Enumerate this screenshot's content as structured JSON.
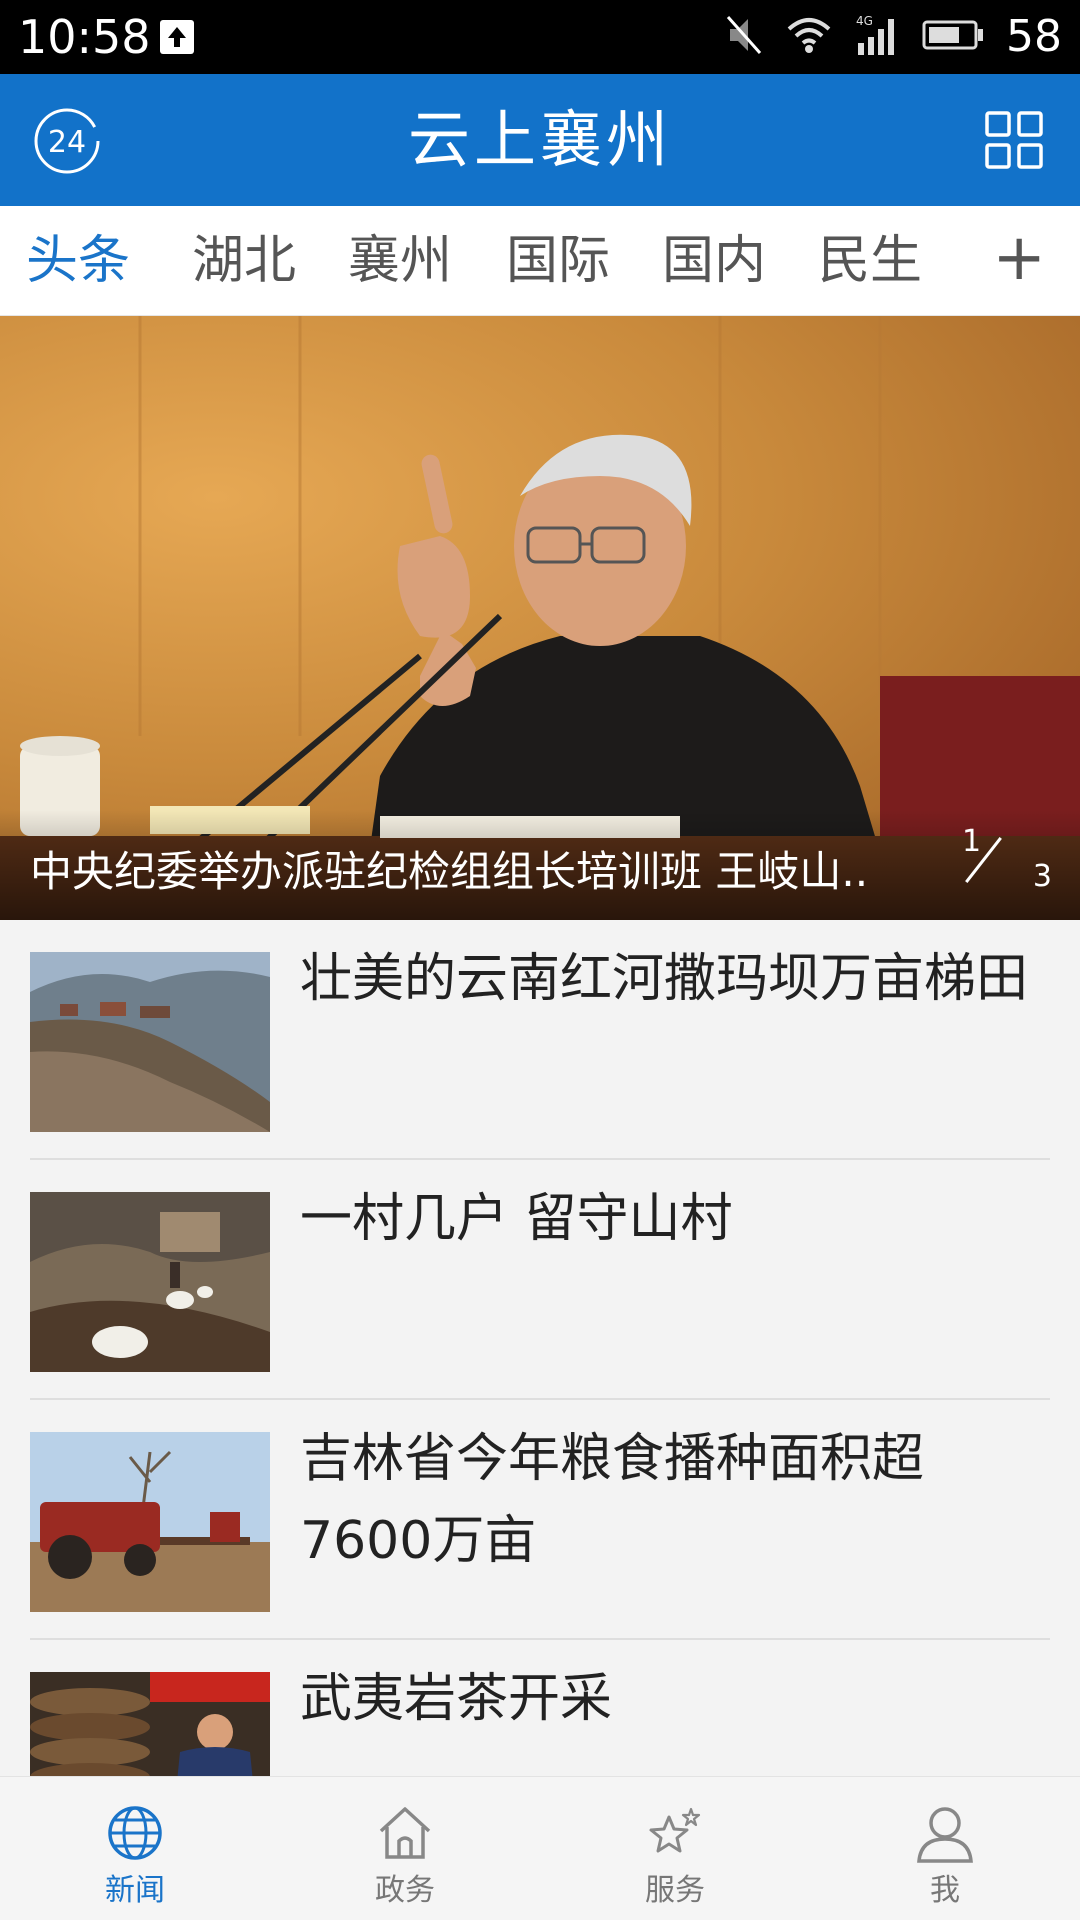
{
  "status_bar": {
    "time": "10:58",
    "battery": "58"
  },
  "header": {
    "title": "云上襄州",
    "left_badge": "24"
  },
  "tabs": [
    {
      "label": "头条",
      "active": true
    },
    {
      "label": "湖北",
      "active": false
    },
    {
      "label": "襄州",
      "active": false
    },
    {
      "label": "国际",
      "active": false
    },
    {
      "label": "国内",
      "active": false
    },
    {
      "label": "民生",
      "active": false
    }
  ],
  "tab_add_label": "+",
  "hero": {
    "caption": "中央纪委举办派驻纪检组组长培训班 王岐山..",
    "pager_current": "1",
    "pager_total": "3"
  },
  "news": [
    {
      "title": "壮美的云南红河撒玛坝万亩梯田"
    },
    {
      "title": "一村几户 留守山村"
    },
    {
      "title": "吉林省今年粮食播种面积超7600万亩"
    },
    {
      "title": "武夷岩茶开采"
    }
  ],
  "nav": [
    {
      "label": "新闻",
      "icon": "globe-icon",
      "active": true
    },
    {
      "label": "政务",
      "icon": "home-icon",
      "active": false
    },
    {
      "label": "服务",
      "icon": "stars-icon",
      "active": false
    },
    {
      "label": "我",
      "icon": "person-icon",
      "active": false
    }
  ],
  "colors": {
    "brand": "#1272c9",
    "active_tab": "#1a74c9"
  }
}
